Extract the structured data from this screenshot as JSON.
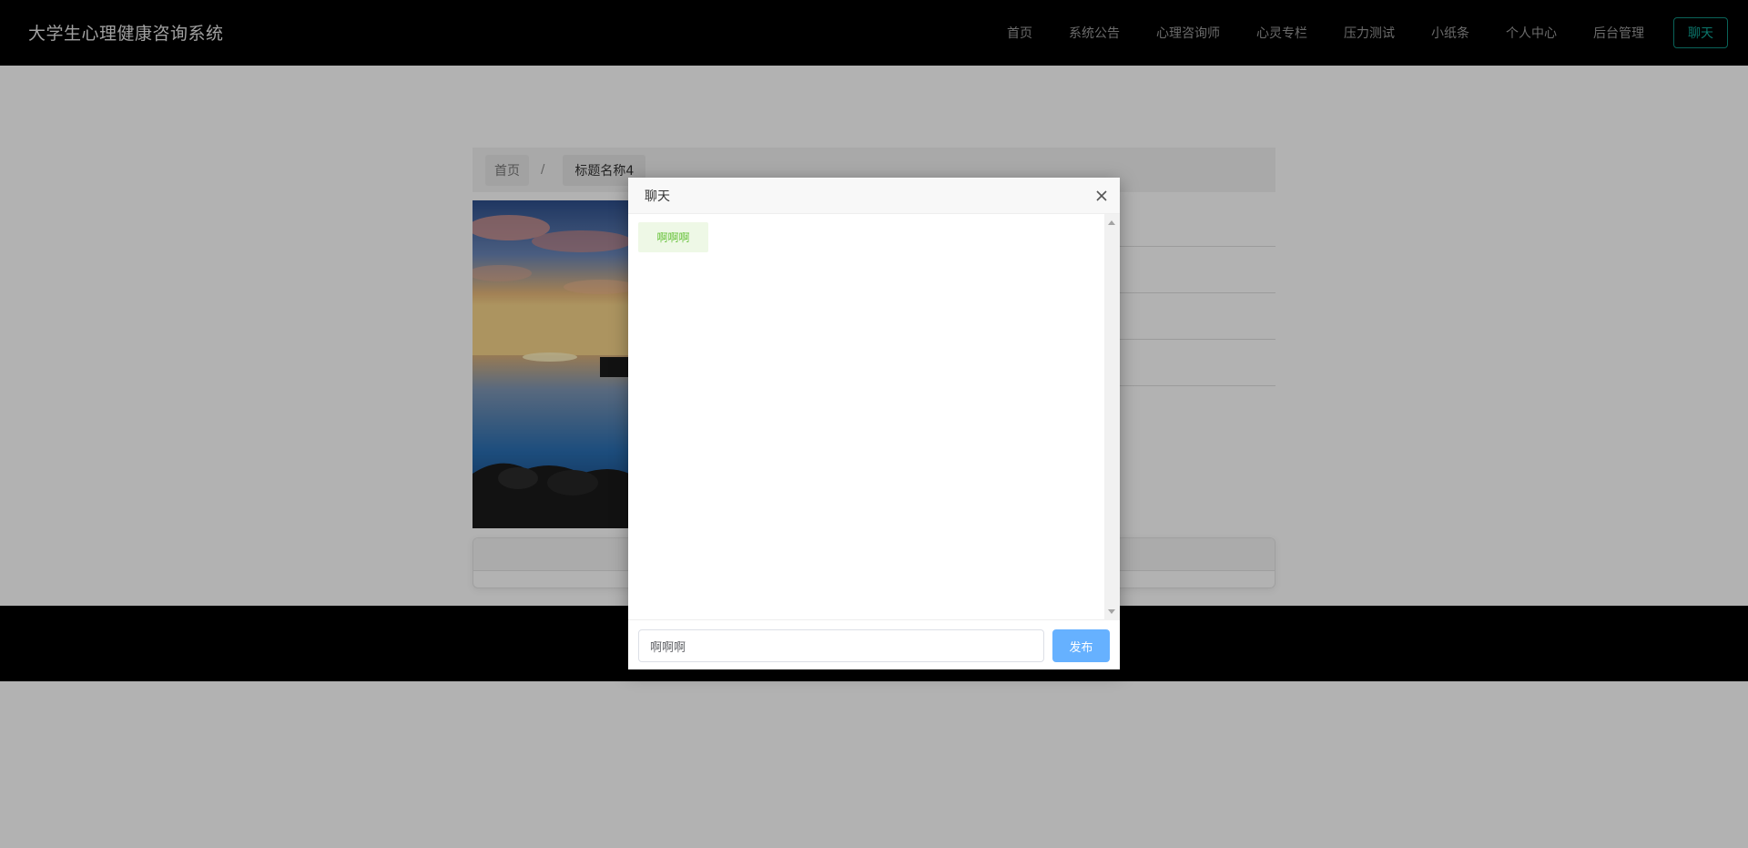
{
  "app": {
    "brand": "大学生心理健康咨询系统"
  },
  "nav": {
    "items": [
      {
        "label": "首页"
      },
      {
        "label": "系统公告"
      },
      {
        "label": "心理咨询师"
      },
      {
        "label": "心灵专栏"
      },
      {
        "label": "压力测试"
      },
      {
        "label": "小纸条"
      },
      {
        "label": "个人中心"
      },
      {
        "label": "后台管理"
      }
    ],
    "chat_button": "聊天",
    "chat_button_color": "#10a99a"
  },
  "breadcrumb": {
    "home": "首页",
    "separator": "/",
    "current": "标题名称4"
  },
  "chat_dialog": {
    "title": "聊天",
    "close_icon": "close-icon",
    "messages": [
      {
        "text": "啊啊啊"
      }
    ],
    "input_value": "啊啊啊",
    "send_label": "发布",
    "send_color": "#66b1ff",
    "bubble_color": "#67c23a"
  }
}
